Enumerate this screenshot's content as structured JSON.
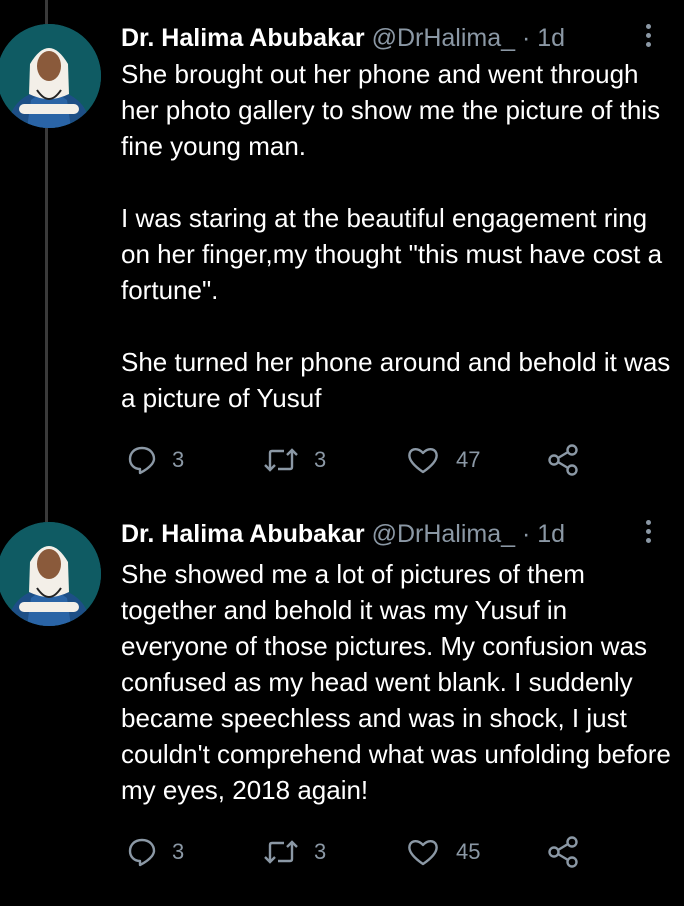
{
  "tweets": [
    {
      "author": {
        "name": "Dr. Halima Abubakar",
        "handle": "@DrHalima_",
        "separator": "·",
        "time": "1d"
      },
      "text": "She brought out her phone and went through her photo gallery to show me the picture of this fine young man.\n\nI was staring at the beautiful engagement ring on her finger,my thought \"this must have cost a fortune\".\n\nShe turned her phone around and behold it was a picture of Yusuf",
      "replies": "3",
      "retweets": "3",
      "likes": "47"
    },
    {
      "author": {
        "name": "Dr. Halima Abubakar",
        "handle": "@DrHalima_",
        "separator": "·",
        "time": "1d"
      },
      "text": "She showed me a lot of pictures of them together and behold it was my Yusuf in everyone of those pictures. My confusion was confused as my head went blank. I suddenly became speechless and was in shock, I just couldn't comprehend what was unfolding before my eyes, 2018 again!",
      "replies": "3",
      "retweets": "3",
      "likes": "45"
    }
  ],
  "icons": {
    "reply": "reply-icon",
    "retweet": "retweet-icon",
    "like": "heart-icon",
    "share": "share-icon",
    "more": "more-vertical-icon"
  },
  "colors": {
    "background": "#000000",
    "text": "#ffffff",
    "secondary": "#8b98a5",
    "thread_line": "#3a3a3a"
  }
}
